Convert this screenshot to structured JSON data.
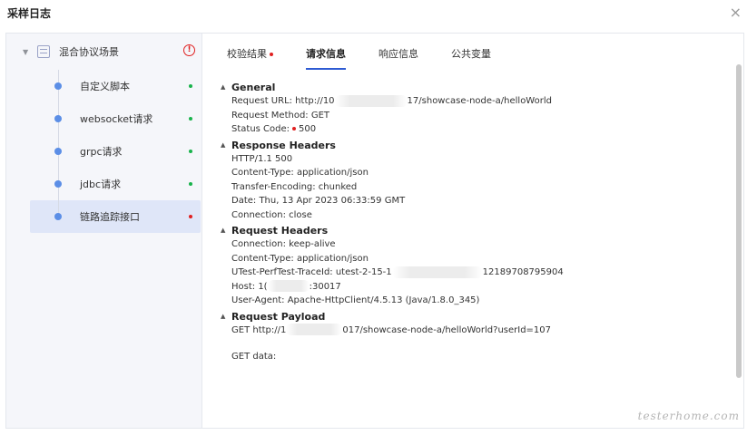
{
  "dialog": {
    "title": "采样日志",
    "close": "×"
  },
  "tree": {
    "root": {
      "label": "混合协议场景",
      "warn": "!"
    },
    "items": [
      {
        "label": "自定义脚本",
        "status": "success",
        "color": "#19b34b"
      },
      {
        "label": "websocket请求",
        "status": "success",
        "color": "#19b34b"
      },
      {
        "label": "grpc请求",
        "status": "success",
        "color": "#19b34b"
      },
      {
        "label": "jdbc请求",
        "status": "success",
        "color": "#19b34b"
      },
      {
        "label": "链路追踪接口",
        "status": "error",
        "color": "#e02020",
        "selected": true
      }
    ]
  },
  "tabs": [
    {
      "label": "校验结果",
      "has_error_dot": true
    },
    {
      "label": "请求信息",
      "active": true
    },
    {
      "label": "响应信息"
    },
    {
      "label": "公共变量"
    }
  ],
  "general": {
    "title": "General",
    "url_prefix": "Request URL: http://10",
    "url_suffix": "17/showcase-node-a/helloWorld",
    "method": "Request Method: GET",
    "status_label": "Status Code:",
    "status_value": "500"
  },
  "response_headers": {
    "title": "Response Headers",
    "lines": [
      "HTTP/1.1 500",
      "Content-Type: application/json",
      "Transfer-Encoding: chunked",
      "Date: Thu, 13 Apr 2023 06:33:59 GMT",
      "Connection: close"
    ]
  },
  "request_headers": {
    "title": "Request Headers",
    "connection": "Connection: keep-alive",
    "content_type": "Content-Type: application/json",
    "trace_prefix": "UTest-PerfTest-TraceId: utest-2-15-1",
    "trace_suffix": "12189708795904",
    "host_prefix": "Host: 1(",
    "host_suffix": ":30017",
    "user_agent": "User-Agent: Apache-HttpClient/4.5.13 (Java/1.8.0_345)"
  },
  "request_payload": {
    "title": "Request Payload",
    "get_prefix": "GET http://1",
    "get_suffix": "017/showcase-node-a/helloWorld?userId=107",
    "get_data": "GET data:"
  },
  "watermark": "testerhome.com"
}
